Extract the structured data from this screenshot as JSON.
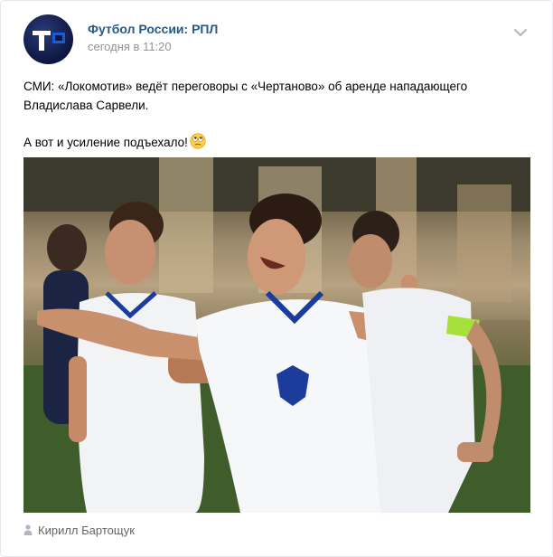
{
  "post": {
    "author": "Футбол России: РПЛ",
    "date": "сегодня в 11:20",
    "text_line1": "СМИ: «Локомотив» ведёт переговоры с «Чертаново» об аренде нападающего Владислава Сарвели.",
    "text_line2": "А вот и усиление подъехало!",
    "emoji": "rolling-eyes-emoji",
    "credit": "Кирилл Бартощук"
  },
  "colors": {
    "link": "#2a5885",
    "meta": "#939393",
    "credit": "#656565"
  }
}
